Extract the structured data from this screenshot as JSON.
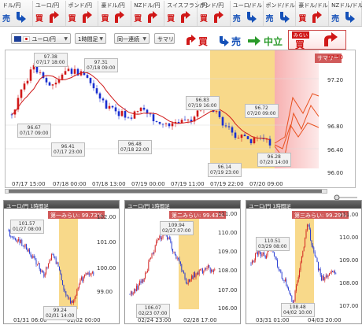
{
  "pairs": [
    {
      "name": "ドル/円",
      "kind": "売"
    },
    {
      "name": "ユーロ/円",
      "kind": "買"
    },
    {
      "name": "ポンド/円",
      "kind": "買"
    },
    {
      "name": "豪ドル/円",
      "kind": "買"
    },
    {
      "name": "NZドル/円",
      "kind": "買"
    },
    {
      "name": "スイスフラン/円",
      "kind": "買"
    },
    {
      "name": "ランド/円",
      "kind": "買"
    },
    {
      "name": "ユーロ/ドル",
      "kind": "売"
    },
    {
      "name": "ポンド/ドル",
      "kind": "売"
    },
    {
      "name": "豪ドル/ドル",
      "kind": "買"
    },
    {
      "name": "NZドル/ドル",
      "kind": "売"
    }
  ],
  "toolbar": {
    "pair_select": "ユーロ/円",
    "timeframe_select": "1時間足",
    "continuous_select": "同一連続",
    "summary_button": "サマリ",
    "buy_label": "買",
    "sell_label": "売",
    "neutral_label": "中立",
    "forecast_caption": "みらい",
    "forecast_label": "買"
  },
  "colors": {
    "buy": "#d01818",
    "sell": "#1450b8",
    "forecast": "#e8501e",
    "highlight": "#f8d98a"
  },
  "main_chart": {
    "summary_label": "サマリー",
    "y_ticks": [
      "97.20",
      "96.80",
      "96.40",
      "96.00"
    ],
    "x_ticks": [
      "07/17 15:00",
      "07/18 00:00",
      "07/18 13:00",
      "07/19 00:00",
      "07/19 11:00",
      "07/19 22:00",
      "07/20 09:00"
    ],
    "callouts": [
      {
        "line1": "97.38",
        "line2": "07/17 18:00"
      },
      {
        "line1": "97.31",
        "line2": "07/18 09:00"
      },
      {
        "line1": "96.67",
        "line2": "07/17 09:00"
      },
      {
        "line1": "96.41",
        "line2": "07/17 23:00"
      },
      {
        "line1": "96.83",
        "line2": "07/19 16:00"
      },
      {
        "line1": "96.48",
        "line2": "07/18 22:00"
      },
      {
        "line1": "96.72",
        "line2": "07/20 09:00"
      },
      {
        "line1": "96.14",
        "line2": "07/19 23:00"
      },
      {
        "line1": "96.28",
        "line2": "07/20 14:00"
      }
    ]
  },
  "subcharts": [
    {
      "title": "ユーロ/円 1時間足",
      "badge": "第一みらい: 99.73%",
      "y_ticks": [
        "102.00",
        "101.00",
        "100.00",
        "99.00"
      ],
      "x_ticks": [
        "01/31 06:00",
        "02/02 00:00"
      ],
      "callouts": [
        {
          "line1": "101.57",
          "line2": "01/27 08:00"
        },
        {
          "line1": "99.24",
          "line2": "02/01 14:00"
        }
      ]
    },
    {
      "title": "ユーロ/円 1時間足",
      "badge": "第二みらい: 99.43%",
      "y_ticks": [
        "111.00",
        "110.00",
        "109.00",
        "108.00",
        "107.00",
        "106.00"
      ],
      "x_ticks": [
        "02/24 23:00",
        "02/28 17:00"
      ],
      "callouts": [
        {
          "line1": "109.94",
          "line2": "02/27 07:00"
        },
        {
          "line1": "106.07",
          "line2": "02/23 07:00"
        }
      ]
    },
    {
      "title": "ユーロ/円 1時間足",
      "badge": "第三みらい: 99.29%",
      "y_ticks": [
        "111.00",
        "110.00",
        "109.00",
        "108.00",
        "107.00"
      ],
      "x_ticks": [
        "03/31 01:00",
        "04/03 20:00"
      ],
      "callouts": [
        {
          "line1": "110.51",
          "line2": "03/29 08:00"
        },
        {
          "line1": "108.48",
          "line2": "04/02 10:00"
        }
      ]
    }
  ]
}
